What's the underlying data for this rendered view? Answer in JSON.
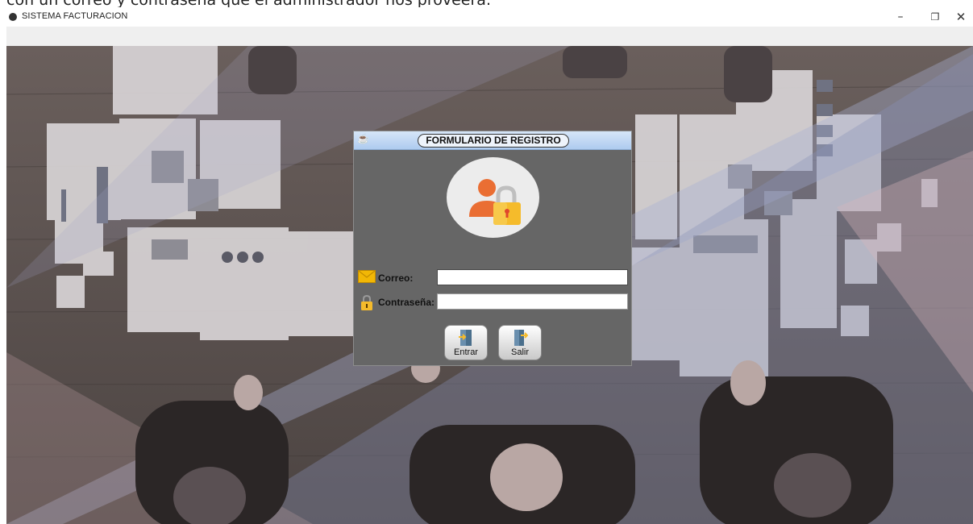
{
  "document": {
    "clipped_text": "con un correo y contraseña que el administrador nos proveerá."
  },
  "window": {
    "title": "SISTEMA FACTURACION",
    "minimize_glyph": "–",
    "maximize_glyph": "❐",
    "close_glyph": "✕"
  },
  "dialog": {
    "title": "FORMULARIO DE REGISTRO",
    "email": {
      "label": "Correo:",
      "value": ""
    },
    "password": {
      "label": "Contraseña:",
      "value": ""
    },
    "buttons": {
      "enter_label": "Entrar",
      "exit_label": "Salir"
    }
  },
  "icons": {
    "app": "app-icon",
    "dialog": "cup-icon",
    "avatar": "user-lock-icon",
    "email": "envelope-icon",
    "password": "padlock-icon",
    "enter": "login-door-icon",
    "exit": "logout-door-icon"
  },
  "colors": {
    "dialog_body": "#666666",
    "dialog_header": "#aecbef",
    "avatar_orange": "#ea6e33",
    "lock_yellow": "#f5bb2b",
    "envelope": "#f2b705",
    "door_blue": "#4a6f8c"
  }
}
